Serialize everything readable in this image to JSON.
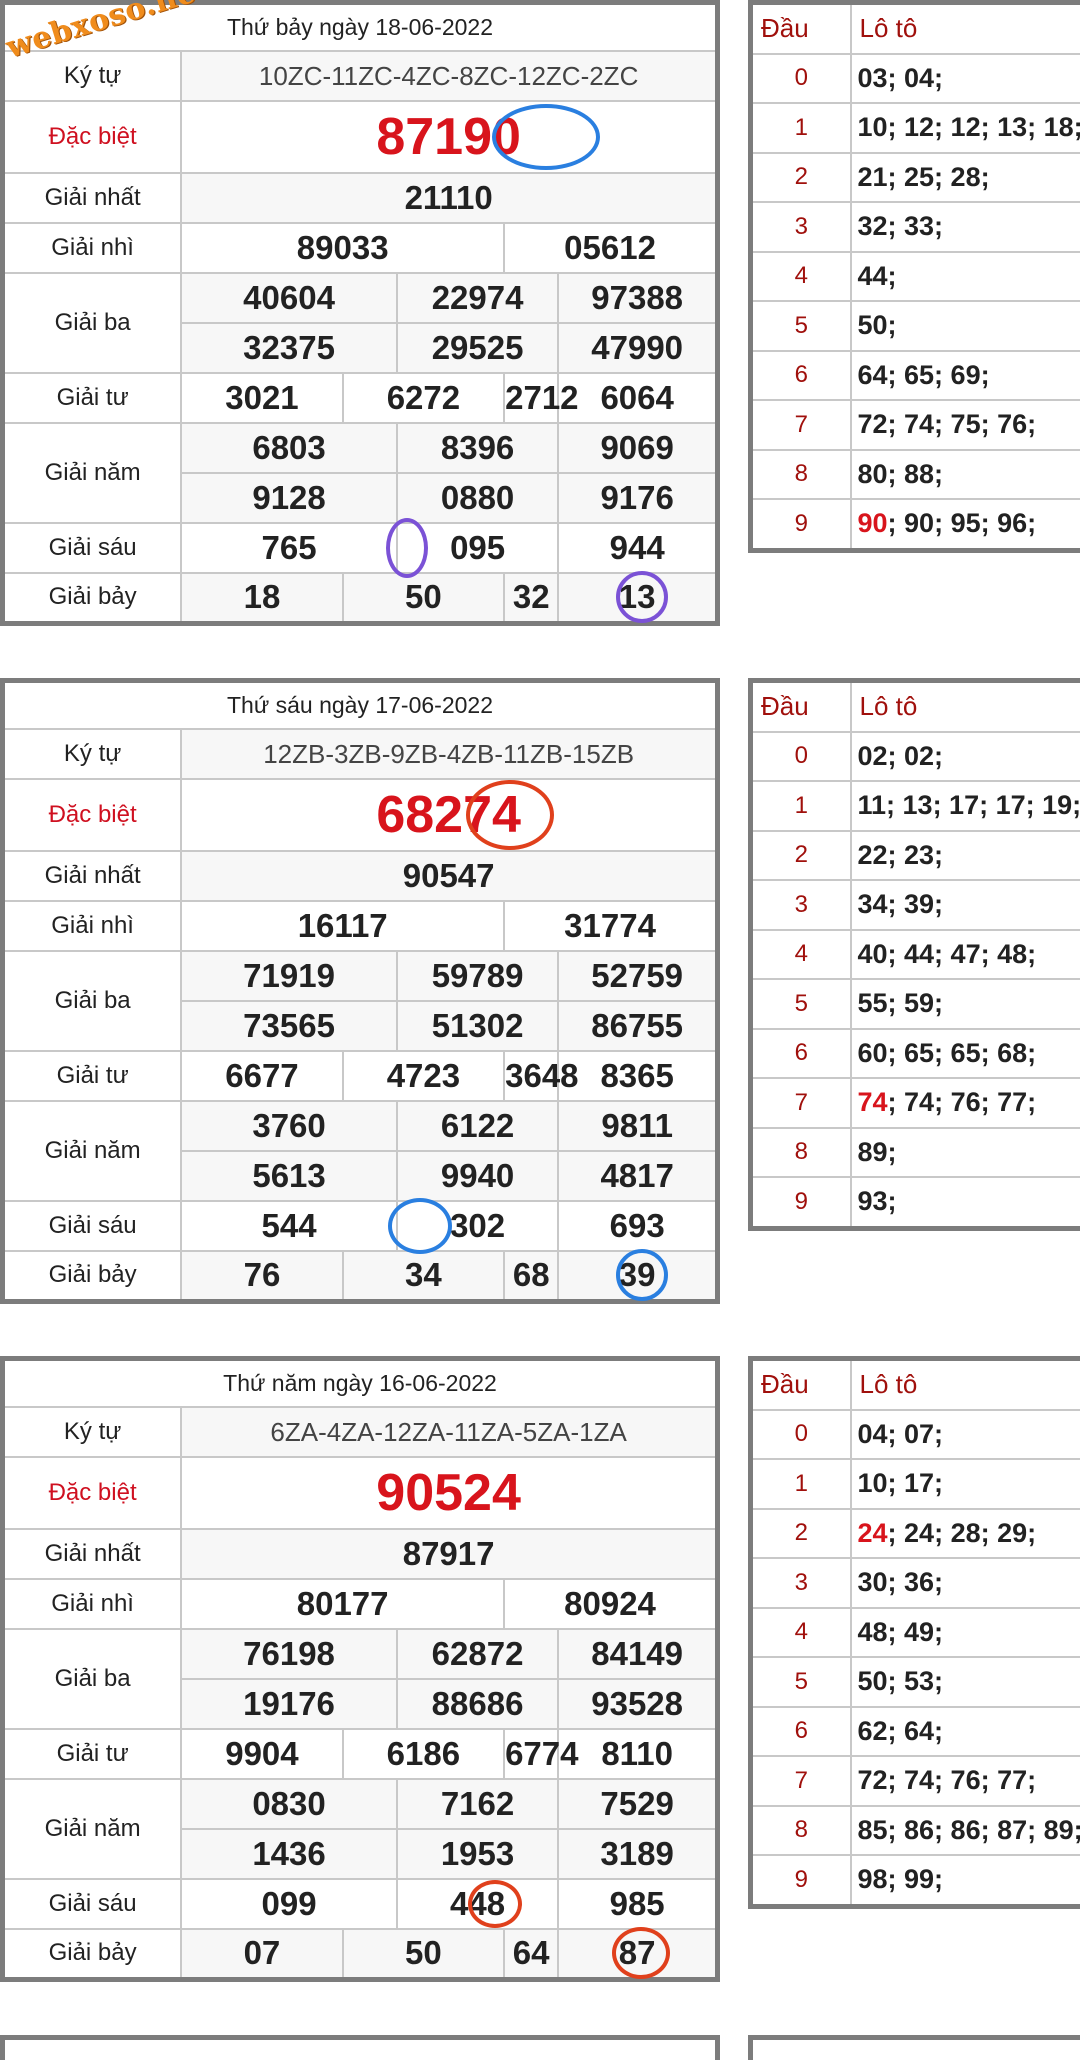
{
  "watermark": "webxoso.net",
  "labels": {
    "ky_tu": "Ký tự",
    "dac_biet": "Đặc biệt",
    "giai_nhat": "Giải nhất",
    "giai_nhi": "Giải nhì",
    "giai_ba": "Giải ba",
    "giai_tu": "Giải tư",
    "giai_nam": "Giải năm",
    "giai_sau": "Giải sáu",
    "giai_bay": "Giải bảy",
    "dau": "Đầu",
    "loto": "Lô tô"
  },
  "draws": [
    {
      "date": "Thứ bảy ngày 18-06-2022",
      "ky_tu": "10ZC-11ZC-4ZC-8ZC-12ZC-2ZC",
      "dac_biet": "87190",
      "giai_nhat": "21110",
      "giai_nhi": [
        "89033",
        "05612"
      ],
      "giai_ba": [
        "40604",
        "22974",
        "97388",
        "32375",
        "29525",
        "47990"
      ],
      "giai_tu": [
        "3021",
        "6272",
        "2712",
        "6064"
      ],
      "giai_nam": [
        "6803",
        "8396",
        "9069",
        "9128",
        "0880",
        "9176"
      ],
      "giai_sau": [
        "765",
        "095",
        "944"
      ],
      "giai_bay": [
        "18",
        "50",
        "32",
        "13"
      ],
      "loto": [
        {
          "dau": "0",
          "hl": "",
          "rest": "03; 04;"
        },
        {
          "dau": "1",
          "hl": "",
          "rest": "10; 12; 12; 13; 18;"
        },
        {
          "dau": "2",
          "hl": "",
          "rest": "21; 25; 28;"
        },
        {
          "dau": "3",
          "hl": "",
          "rest": "32; 33;"
        },
        {
          "dau": "4",
          "hl": "",
          "rest": "44;"
        },
        {
          "dau": "5",
          "hl": "",
          "rest": "50;"
        },
        {
          "dau": "6",
          "hl": "",
          "rest": "64; 65; 69;"
        },
        {
          "dau": "7",
          "hl": "",
          "rest": "72; 74; 75; 76;"
        },
        {
          "dau": "8",
          "hl": "",
          "rest": "80; 88;"
        },
        {
          "dau": "9",
          "hl": "90",
          "rest": "; 90; 95; 96;"
        }
      ]
    },
    {
      "date": "Thứ sáu ngày 17-06-2022",
      "ky_tu": "12ZB-3ZB-9ZB-4ZB-11ZB-15ZB",
      "dac_biet": "68274",
      "giai_nhat": "90547",
      "giai_nhi": [
        "16117",
        "31774"
      ],
      "giai_ba": [
        "71919",
        "59789",
        "52759",
        "73565",
        "51302",
        "86755"
      ],
      "giai_tu": [
        "6677",
        "4723",
        "3648",
        "8365"
      ],
      "giai_nam": [
        "3760",
        "6122",
        "9811",
        "5613",
        "9940",
        "4817"
      ],
      "giai_sau": [
        "544",
        "302",
        "693"
      ],
      "giai_bay": [
        "76",
        "34",
        "68",
        "39"
      ],
      "loto": [
        {
          "dau": "0",
          "hl": "",
          "rest": "02; 02;"
        },
        {
          "dau": "1",
          "hl": "",
          "rest": "11; 13; 17; 17; 19;"
        },
        {
          "dau": "2",
          "hl": "",
          "rest": "22; 23;"
        },
        {
          "dau": "3",
          "hl": "",
          "rest": "34; 39;"
        },
        {
          "dau": "4",
          "hl": "",
          "rest": "40; 44; 47; 48;"
        },
        {
          "dau": "5",
          "hl": "",
          "rest": "55; 59;"
        },
        {
          "dau": "6",
          "hl": "",
          "rest": "60; 65; 65; 68;"
        },
        {
          "dau": "7",
          "hl": "74",
          "rest": "; 74; 76; 77;"
        },
        {
          "dau": "8",
          "hl": "",
          "rest": "89;"
        },
        {
          "dau": "9",
          "hl": "",
          "rest": "93;"
        }
      ]
    },
    {
      "date": "Thứ năm ngày 16-06-2022",
      "ky_tu": "6ZA-4ZA-12ZA-11ZA-5ZA-1ZA",
      "dac_biet": "90524",
      "giai_nhat": "87917",
      "giai_nhi": [
        "80177",
        "80924"
      ],
      "giai_ba": [
        "76198",
        "62872",
        "84149",
        "19176",
        "88686",
        "93528"
      ],
      "giai_tu": [
        "9904",
        "6186",
        "6774",
        "8110"
      ],
      "giai_nam": [
        "0830",
        "7162",
        "7529",
        "1436",
        "1953",
        "3189"
      ],
      "giai_sau": [
        "099",
        "448",
        "985"
      ],
      "giai_bay": [
        "07",
        "50",
        "64",
        "87"
      ],
      "loto": [
        {
          "dau": "0",
          "hl": "",
          "rest": "04; 07;"
        },
        {
          "dau": "1",
          "hl": "",
          "rest": "10; 17;"
        },
        {
          "dau": "2",
          "hl": "24",
          "rest": "; 24; 28; 29;"
        },
        {
          "dau": "3",
          "hl": "",
          "rest": "30; 36;"
        },
        {
          "dau": "4",
          "hl": "",
          "rest": "48; 49;"
        },
        {
          "dau": "5",
          "hl": "",
          "rest": "50; 53;"
        },
        {
          "dau": "6",
          "hl": "",
          "rest": "62; 64;"
        },
        {
          "dau": "7",
          "hl": "",
          "rest": "72; 74; 76; 77;"
        },
        {
          "dau": "8",
          "hl": "",
          "rest": "85; 86; 86; 87; 89;"
        },
        {
          "dau": "9",
          "hl": "",
          "rest": "98; 99;"
        }
      ]
    }
  ],
  "highlight_colors": [
    "#2a7fe0",
    "#7b52d6",
    "#2a7fe0",
    "#e0401c",
    "#e0401c"
  ]
}
